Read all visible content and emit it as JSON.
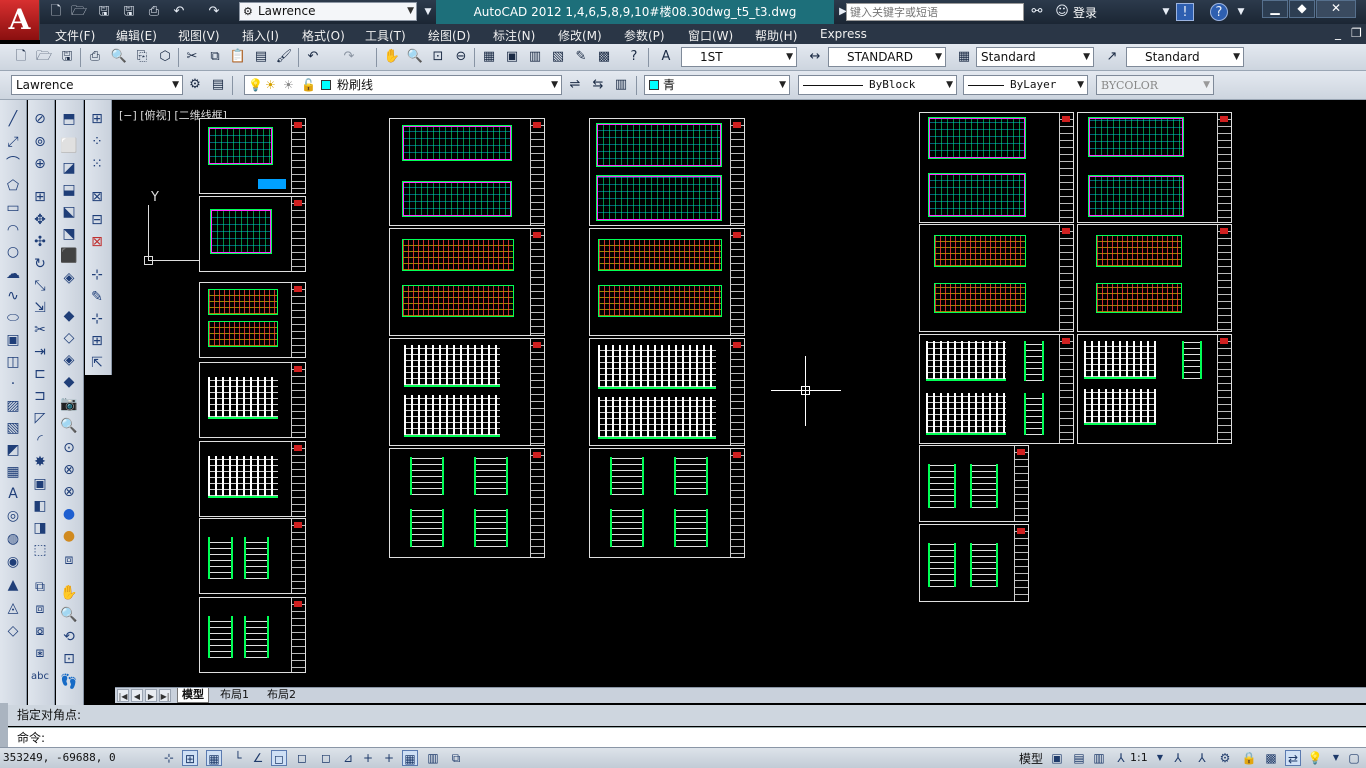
{
  "title_bar": {
    "app_logo": "A",
    "workspace": "Lawrence",
    "title": "AutoCAD 2012    1,4,6,5,8,9,10#楼08.30dwg_t5_t3.dwg",
    "search_placeholder": "键入关键字或短语",
    "login": "登录"
  },
  "menu": {
    "items": [
      "文件(F)",
      "编辑(E)",
      "视图(V)",
      "插入(I)",
      "格式(O)",
      "工具(T)",
      "绘图(D)",
      "标注(N)",
      "修改(M)",
      "参数(P)",
      "窗口(W)",
      "帮助(H)",
      "Express"
    ]
  },
  "styles_toolbar": {
    "text_style": "1ST",
    "dim_style": "STANDARD",
    "table_style": "Standard",
    "multileader_style": "Standard"
  },
  "layers_toolbar": {
    "workspace_combo": "Lawrence",
    "layer_name": "粉刷线",
    "color": "青",
    "color_hex": "#00ffff",
    "linetype": "ByBlock",
    "lineweight": "ByLayer",
    "plotstyle": "BYCOLOR"
  },
  "canvas": {
    "view_label": "[−] [俯视] [二维线框]",
    "ucs_y_label": "Y"
  },
  "tabs": [
    "模型",
    "布局1",
    "布局2"
  ],
  "command": {
    "history_line": "指定对角点:",
    "prompt": "命令:"
  },
  "status": {
    "coordinates": "353249, -69688, 0",
    "model_label": "模型",
    "scale": "1:1"
  }
}
